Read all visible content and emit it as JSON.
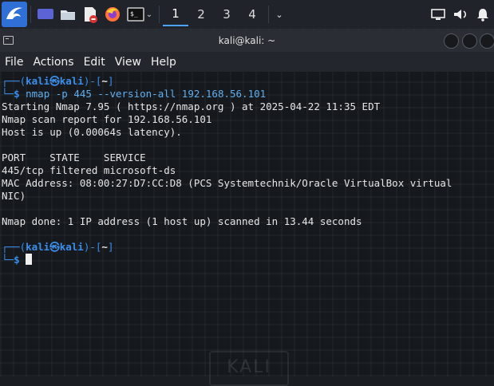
{
  "panel": {
    "workspaces": [
      "1",
      "2",
      "3",
      "4"
    ],
    "active_workspace": "1"
  },
  "window": {
    "title": "kali@kali: ~"
  },
  "menu": [
    "File",
    "Actions",
    "Edit",
    "View",
    "Help"
  ],
  "terminal": {
    "prompt1_user": "kali",
    "prompt1_host": "kali",
    "prompt1_dir": "~",
    "command": "nmap -p 445 --version-all 192.168.56.101",
    "output": [
      "Starting Nmap 7.95 ( https://nmap.org ) at 2025-04-22 11:35 EDT",
      "Nmap scan report for 192.168.56.101",
      "Host is up (0.00064s latency).",
      "",
      "PORT    STATE    SERVICE",
      "445/tcp filtered microsoft-ds",
      "MAC Address: 08:00:27:D7:CC:D8 (PCS Systemtechnik/Oracle VirtualBox virtual",
      "NIC)",
      "",
      "Nmap done: 1 IP address (1 host up) scanned in 13.44 seconds",
      ""
    ],
    "prompt2_user": "kali",
    "prompt2_host": "kali",
    "prompt2_dir": "~"
  },
  "watermark": "KALI",
  "icons": {
    "menu": "kali-dragon-icon",
    "taskbar": [
      "desktop-icon",
      "files-icon",
      "text-editor-icon",
      "firefox-icon",
      "terminal-icon"
    ],
    "tray": [
      "display-icon",
      "volume-icon",
      "notification-icon"
    ]
  }
}
